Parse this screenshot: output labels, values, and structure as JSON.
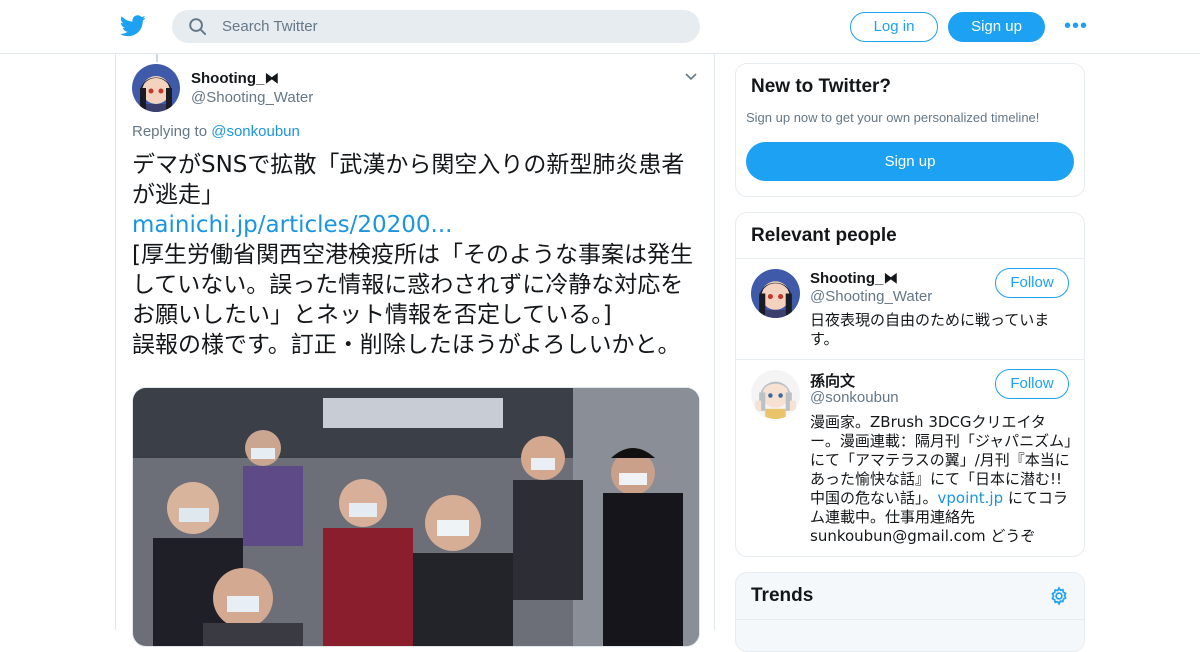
{
  "nav": {
    "search_placeholder": "Search Twitter",
    "login_label": "Log in",
    "signup_label": "Sign up",
    "more_label": "•••",
    "logo_icon": "twitter-bird-icon",
    "accent_color": "#1da1f2"
  },
  "tweet": {
    "author_name": "Shooting_⧓",
    "author_handle": "@Shooting_Water",
    "replying_prefix": "Replying to",
    "replying_handle": "@sonkoubun",
    "text_line1": "デマがSNSで拡散「武漢から関空入りの新型肺炎患者が逃走」",
    "link": "mainichi.jp/articles/20200...",
    "text_body": "[厚生労働省関西空港検疫所は「そのような事案は発生していない。誤った情報に惑わされずに冷静な対応をお願いしたい」とネット情報を否定している。]",
    "text_tail": "誤報の様です。訂正・削除したほうがよろしいかと。"
  },
  "sidebar": {
    "new_title": "New to Twitter?",
    "new_sub": "Sign up now to get your own personalized timeline!",
    "new_signup": "Sign up",
    "relevant_title": "Relevant people",
    "people": [
      {
        "name": "Shooting_⧓",
        "handle": "@Shooting_Water",
        "follow": "Follow",
        "bio": "日夜表現の自由のために戦っています。"
      },
      {
        "name": "孫向文",
        "handle": "@sonkoubun",
        "follow": "Follow",
        "bio_pre": "漫画家。ZBrush 3DCGクリエイター。漫画連載：隔月刊「ジャパニズム」にて「アマテラスの翼」/月刊『本当にあった愉快な話』にて「日本に潜む!!中国の危ない話」。",
        "bio_link": "vpoint.jp",
        "bio_post": " にてコラム連載中。仕事用連絡先 sunkoubun@gmail.com どうぞ"
      }
    ],
    "trends_title": "Trends"
  }
}
